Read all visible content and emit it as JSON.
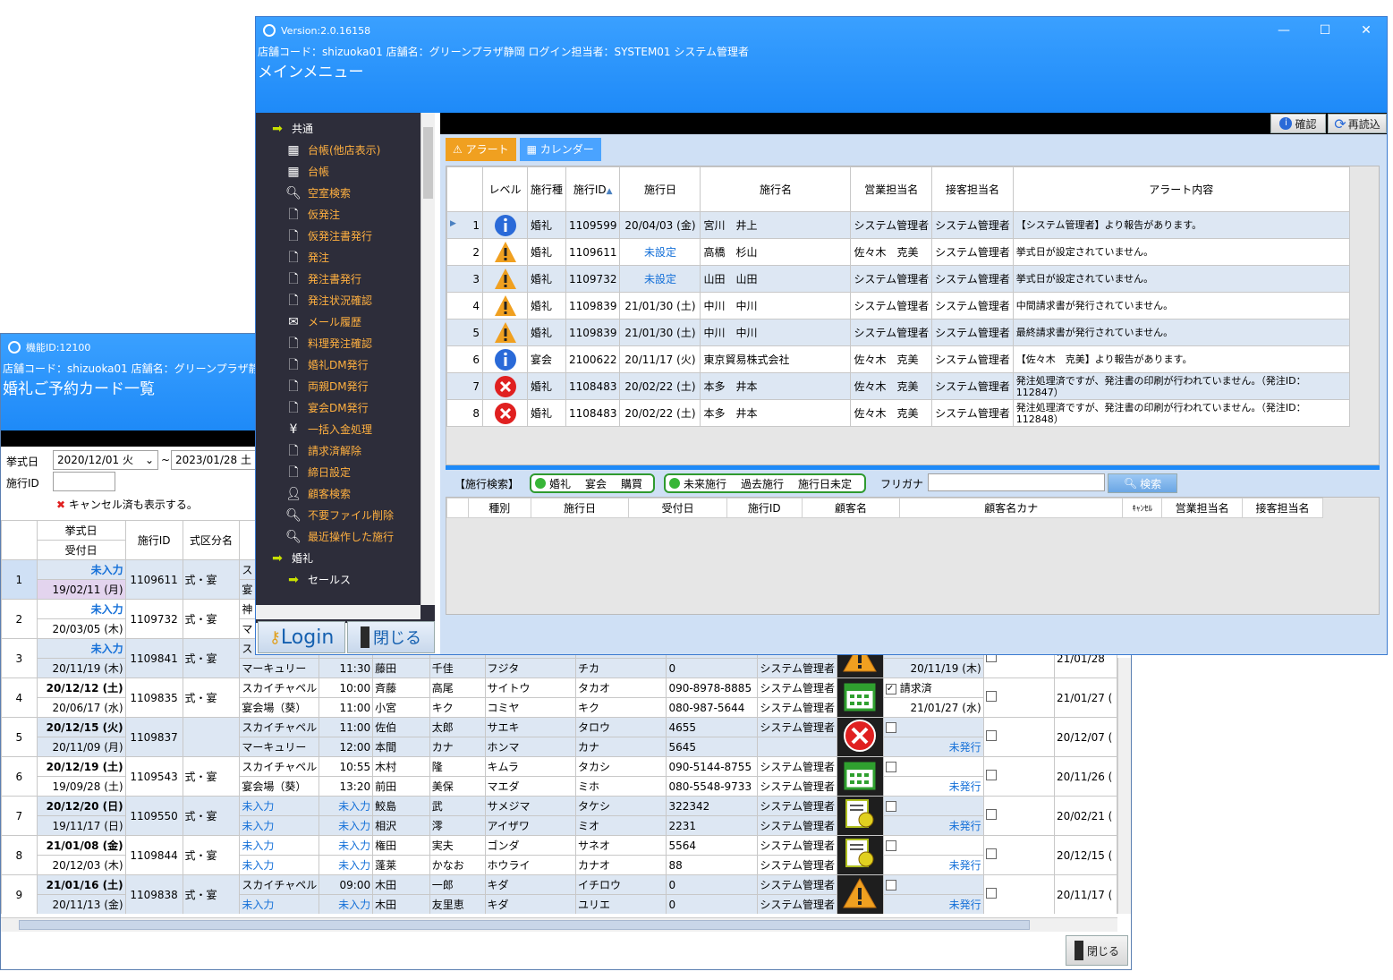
{
  "back": {
    "title": "機能ID:12100",
    "store": "店舗コード：shizuoka01 店舗名：グリーンプラザ静",
    "heading": "婚礼ご予約カード一覧",
    "filter": {
      "date_label": "挙式日",
      "date_from": "2020/12/01 火",
      "tilde": "~",
      "date_to": "2023/01/28 土",
      "id_label": "施行ID",
      "cancel_label": "キャンセル済も表示する。"
    },
    "columns": {
      "date": "挙式日",
      "recv": "受付日",
      "id": "施行ID",
      "type": "式区分名"
    },
    "rows": [
      {
        "no": "1",
        "d1": "未入力",
        "d2": "19/02/11 (月)",
        "id": "1109611",
        "kind": "式・宴",
        "l1": "ス",
        "l2": "宴"
      },
      {
        "no": "2",
        "d1": "未入力",
        "d2": "20/03/05 (木)",
        "id": "1109732",
        "kind": "式・宴",
        "l1": "神",
        "l2": "マ"
      },
      {
        "no": "3",
        "d1": "未入力",
        "d2": "20/11/19 (木)",
        "id": "1109841",
        "kind": "式・宴",
        "l1": "ス",
        "l2": "マーキュリー",
        "t2": "11:30",
        "n2": "藤田",
        "f2": "千佳",
        "k2": "フジタ",
        "g2": "チカ",
        "p2": "0",
        "s2": "システム管理者",
        "icon": "warning",
        "r2": "20/11/19 (木)",
        "last": "21/01/28"
      },
      {
        "no": "4",
        "d1": "20/12/12 (土)",
        "d2": "20/06/17 (水)",
        "id": "1109835",
        "kind": "式・宴",
        "l1": "スカイチャペル",
        "t1": "10:00",
        "n1": "斉藤",
        "f1": "高尾",
        "k1": "サイトウ",
        "g1": "タカオ",
        "p1": "090-8978-8885",
        "s1": "システム管理者",
        "l2": "宴会場（葵）",
        "t2": "11:00",
        "n2": "小宮",
        "f2": "キク",
        "k2": "コミヤ",
        "g2": "キク",
        "p2": "080-987-5644",
        "s2": "システム管理者",
        "icon": "calendar",
        "r1": "請求済",
        "r2": "21/01/27 (水)",
        "last": "21/01/27 ("
      },
      {
        "no": "5",
        "d1": "20/12/15 (火)",
        "d2": "20/11/09 (月)",
        "id": "1109837",
        "kind": "",
        "l1": "スカイチャペル",
        "t1": "11:00",
        "n1": "佐伯",
        "f1": "太郎",
        "k1": "サエキ",
        "g1": "タロウ",
        "p1": "4655",
        "s1": "システム管理者",
        "l2": "マーキュリー",
        "t2": "12:00",
        "n2": "本間",
        "f2": "カナ",
        "k2": "ホンマ",
        "g2": "カナ",
        "p2": "5645",
        "s2": "",
        "icon": "error",
        "r2": "未発行",
        "last": "20/12/07 ("
      },
      {
        "no": "6",
        "d1": "20/12/19 (土)",
        "d2": "19/09/28 (土)",
        "id": "1109543",
        "kind": "式・宴",
        "l1": "スカイチャペル",
        "t1": "10:55",
        "n1": "木村",
        "f1": "隆",
        "k1": "キムラ",
        "g1": "タカシ",
        "p1": "090-5144-8755",
        "s1": "システム管理者",
        "l2": "宴会場（葵）",
        "t2": "13:20",
        "n2": "前田",
        "f2": "美保",
        "k2": "マエダ",
        "g2": "ミホ",
        "p2": "080-5548-9733",
        "s2": "システム管理者",
        "icon": "calendar",
        "r2": "未発行",
        "last": "20/11/26 ("
      },
      {
        "no": "7",
        "d1": "20/12/20 (日)",
        "d2": "19/11/17 (日)",
        "id": "1109550",
        "kind": "式・宴",
        "l1": "未入力",
        "t1": "未入力",
        "n1": "鮫島",
        "f1": "武",
        "k1": "サメジマ",
        "g1": "タケシ",
        "p1": "322342",
        "s1": "システム管理者",
        "l2": "未入力",
        "t2": "未入力",
        "n2": "相沢",
        "f2": "澪",
        "k2": "アイザワ",
        "g2": "ミオ",
        "p2": "2231",
        "s2": "システム管理者",
        "icon": "cert",
        "r2": "未発行",
        "last": "20/02/21 ("
      },
      {
        "no": "8",
        "d1": "21/01/08 (金)",
        "d2": "20/12/03 (木)",
        "id": "1109844",
        "kind": "式・宴",
        "l1": "未入力",
        "t1": "未入力",
        "n1": "権田",
        "f1": "実夫",
        "k1": "ゴンダ",
        "g1": "サネオ",
        "p1": "5564",
        "s1": "システム管理者",
        "l2": "未入力",
        "t2": "未入力",
        "n2": "蓬莱",
        "f2": "かなお",
        "k2": "ホウライ",
        "g2": "カナオ",
        "p2": "88",
        "s2": "システム管理者",
        "icon": "cert",
        "r2": "未発行",
        "last": "20/12/15 ("
      },
      {
        "no": "9",
        "d1": "21/01/16 (土)",
        "d2": "20/11/13 (金)",
        "id": "1109838",
        "kind": "式・宴",
        "l1": "スカイチャペル",
        "t1": "09:00",
        "n1": "木田",
        "f1": "一郎",
        "k1": "キダ",
        "g1": "イチロウ",
        "p1": "0",
        "s1": "システム管理者",
        "l2": "未入力",
        "t2": "未入力",
        "n2": "木田",
        "f2": "友里恵",
        "k2": "キダ",
        "g2": "ユリエ",
        "p2": "0",
        "s2": "システム管理者",
        "icon": "warning",
        "r2": "未発行",
        "last": "20/11/17 ("
      }
    ],
    "close_label": "閉じる"
  },
  "front": {
    "title": "Version:2.0.16158",
    "store": "店舗コード：shizuoka01 店舗名：グリーンプラザ静岡 ログイン担当者：SYSTEM01 システム管理者",
    "heading": "メインメニュー",
    "menu": [
      {
        "label": "共通",
        "type": "group",
        "icon": "arrow-right-icon"
      },
      {
        "label": "台帳(他店表示)",
        "type": "item",
        "icon": "calendar-icon"
      },
      {
        "label": "台帳",
        "type": "item",
        "icon": "calendar-icon"
      },
      {
        "label": "空室検索",
        "type": "item",
        "icon": "search-icon"
      },
      {
        "label": "仮発注",
        "type": "item",
        "icon": "document-icon"
      },
      {
        "label": "仮発注書発行",
        "type": "item",
        "icon": "document-icon"
      },
      {
        "label": "発注",
        "type": "item",
        "icon": "document-icon"
      },
      {
        "label": "発注書発行",
        "type": "item",
        "icon": "document-icon"
      },
      {
        "label": "発注状況確認",
        "type": "item",
        "icon": "document-icon"
      },
      {
        "label": "メール履歴",
        "type": "item",
        "icon": "mail-icon"
      },
      {
        "label": "料理発注確認",
        "type": "item",
        "icon": "document-icon"
      },
      {
        "label": "婚礼DM発行",
        "type": "item",
        "icon": "document-icon"
      },
      {
        "label": "両親DM発行",
        "type": "item",
        "icon": "document-icon"
      },
      {
        "label": "宴会DM発行",
        "type": "item",
        "icon": "document-icon"
      },
      {
        "label": "一括入金処理",
        "type": "item",
        "icon": "yen-icon"
      },
      {
        "label": "請求済解除",
        "type": "item",
        "icon": "document-icon"
      },
      {
        "label": "締日設定",
        "type": "item",
        "icon": "document-icon"
      },
      {
        "label": "顧客検索",
        "type": "item",
        "icon": "user-icon"
      },
      {
        "label": "不要ファイル削除",
        "type": "item",
        "icon": "search-icon"
      },
      {
        "label": "最近操作した施行",
        "type": "item",
        "icon": "search-icon"
      },
      {
        "label": "婚礼",
        "type": "group",
        "icon": "arrow-right-icon"
      },
      {
        "label": "セールス",
        "type": "group",
        "icon": "arrow-right-icon"
      }
    ],
    "login_label": "Login",
    "close_label": "閉じる",
    "confirm_label": "確認",
    "reload_label": "再読込",
    "tabs": {
      "alert": "アラート",
      "calendar": "カレンダー"
    },
    "alert_columns": {
      "level": "レベル",
      "type": "施行種",
      "id": "施行ID",
      "date": "施行日",
      "name": "施行名",
      "sales": "営業担当名",
      "reception": "接客担当名",
      "content": "アラート内容"
    },
    "alerts": [
      {
        "no": "1",
        "level": "info",
        "type": "婚礼",
        "id": "1109599",
        "date": "20/04/03 (金)",
        "name": "宮川　井上",
        "sales": "システム管理者",
        "reception": "システム管理者",
        "content": "【システム管理者】より報告があります。"
      },
      {
        "no": "2",
        "level": "warning",
        "type": "婚礼",
        "id": "1109611",
        "date": "未設定",
        "name": "高橋　杉山",
        "sales": "佐々木　克美",
        "reception": "システム管理者",
        "content": "挙式日が設定されていません。"
      },
      {
        "no": "3",
        "level": "warning",
        "type": "婚礼",
        "id": "1109732",
        "date": "未設定",
        "name": "山田　山田",
        "sales": "システム管理者",
        "reception": "システム管理者",
        "content": "挙式日が設定されていません。"
      },
      {
        "no": "4",
        "level": "warning",
        "type": "婚礼",
        "id": "1109839",
        "date": "21/01/30 (土)",
        "name": "中川　中川",
        "sales": "システム管理者",
        "reception": "システム管理者",
        "content": "中間請求書が発行されていません。"
      },
      {
        "no": "5",
        "level": "warning",
        "type": "婚礼",
        "id": "1109839",
        "date": "21/01/30 (土)",
        "name": "中川　中川",
        "sales": "システム管理者",
        "reception": "システム管理者",
        "content": "最終請求書が発行されていません。"
      },
      {
        "no": "6",
        "level": "info",
        "type": "宴会",
        "id": "2100622",
        "date": "20/11/17 (火)",
        "name": "東京貿易株式会社",
        "sales": "佐々木　克美",
        "reception": "システム管理者",
        "content": "【佐々木　克美】より報告があります。"
      },
      {
        "no": "7",
        "level": "error",
        "type": "婚礼",
        "id": "1108483",
        "date": "20/02/22 (土)",
        "name": "本多　井本",
        "sales": "佐々木　克美",
        "reception": "システム管理者",
        "content": "発注処理済ですが、発注書の印刷が行われていません。（発注ID：112847）"
      },
      {
        "no": "8",
        "level": "error",
        "type": "婚礼",
        "id": "1108483",
        "date": "20/02/22 (土)",
        "name": "本多　井本",
        "sales": "佐々木　克美",
        "reception": "システム管理者",
        "content": "発注処理済ですが、発注書の印刷が行われていません。（発注ID：112848）"
      }
    ],
    "search": {
      "label": "【施行検索】",
      "t1": [
        "婚礼",
        "宴会",
        "購買"
      ],
      "t2": [
        "未来施行",
        "過去施行",
        "施行日未定"
      ],
      "furigana_label": "フリガナ",
      "button": "検索"
    },
    "search_columns": [
      "種別",
      "施行日",
      "受付日",
      "施行ID",
      "顧客名",
      "顧客名カナ",
      "ｷｬﾝｾﾙ",
      "営業担当名",
      "接客担当名"
    ]
  },
  "colors": {
    "header": "#1e8af8",
    "menu_text": "#ffb040",
    "alt_row": "#dde7f3",
    "link": "#1570d8"
  }
}
